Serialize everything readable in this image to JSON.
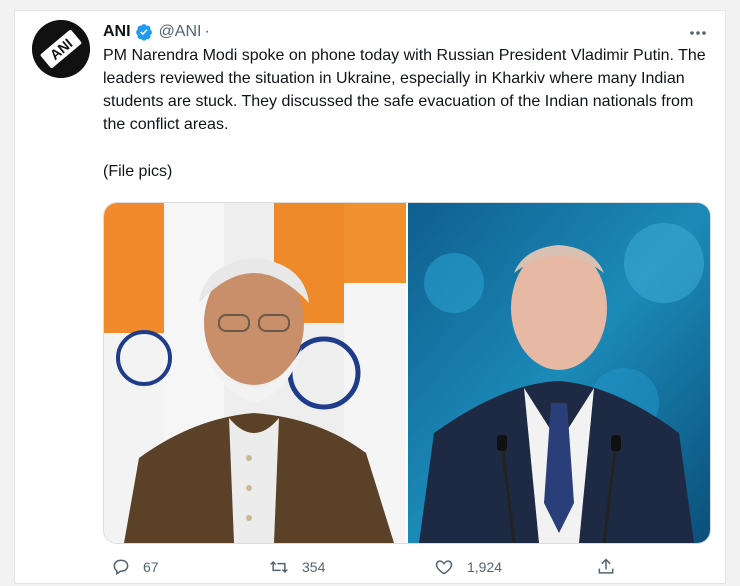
{
  "tweet": {
    "author_name": "ANI",
    "author_handle": "@ANI",
    "separator": "·",
    "avatar_text": "ANI",
    "text": "PM Narendra Modi spoke on phone today with Russian President Vladimir Putin. The leaders reviewed the situation in Ukraine, especially in Kharkiv where many Indian students are stuck. They discussed the safe evacuation of the Indian nationals from the conflict areas.",
    "caption": "(File pics)",
    "more_label": "···"
  },
  "media": {
    "left_description": "left-photo",
    "right_description": "right-photo"
  },
  "actions": {
    "replies": "67",
    "retweets": "354",
    "likes": "1,924"
  },
  "colors": {
    "text": "#0f1419",
    "secondary": "#536471",
    "verified": "#1d9bf0"
  },
  "icons": [
    "verified-badge-icon",
    "more-icon",
    "reply-icon",
    "retweet-icon",
    "like-icon",
    "share-icon"
  ]
}
